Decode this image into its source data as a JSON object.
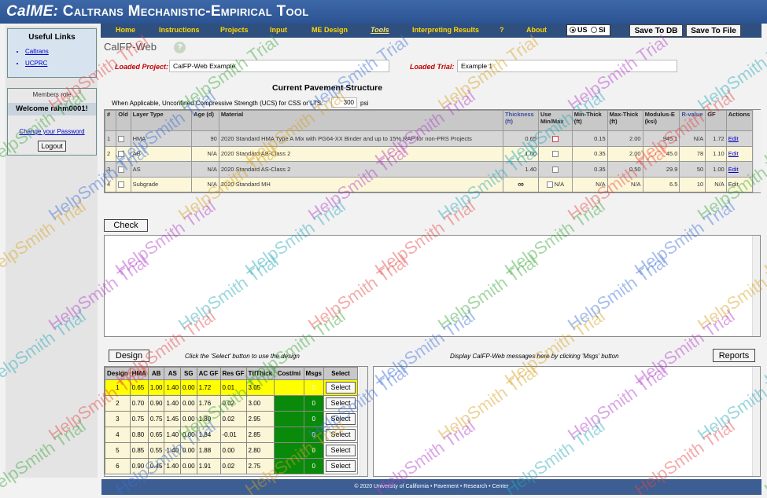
{
  "app": {
    "title_prefix": "CalME:",
    "title_rest": "Caltrans Mechanistic-Empirical Tool"
  },
  "nav": {
    "items": [
      "Home",
      "Instructions",
      "Projects",
      "Input",
      "ME Design",
      "Tools",
      "Interpreting Results",
      "?",
      "About"
    ],
    "active": "Tools"
  },
  "units": {
    "us": "US",
    "si": "SI",
    "selected": "US"
  },
  "buttons": {
    "save_db": "Save To DB",
    "save_file": "Save To File",
    "logout": "Logout",
    "check": "Check",
    "design": "Design",
    "reports": "Reports"
  },
  "sidebar": {
    "useful_links_title": "Useful Links",
    "links": [
      "Caltrans",
      "UCPRC"
    ],
    "members_role": "Members role",
    "welcome": "Welcome rahm0001!",
    "change_password": "Change your Password"
  },
  "page": {
    "title": "CalFP-Web",
    "help_icon": "?",
    "loaded_project_label": "Loaded Project:",
    "loaded_project_value": "CalFP-Web Example",
    "loaded_trial_label": "Loaded Trial:",
    "loaded_trial_value": "Example 1",
    "structure_title": "Current Pavement Structure",
    "ucs_text": "When Applicable, Unconfined Compressive Strength (UCS) for CSS or LTS:",
    "ucs_value": "300",
    "ucs_unit": "psi"
  },
  "structure_table": {
    "headers": [
      "#",
      "Old",
      "Layer Type",
      "Age (d)",
      "Material",
      "Thickness (ft)",
      "Use Min/Max",
      "Min-Thick (ft)",
      "Max-Thick (ft)",
      "Modulus-E (ksi)",
      "R-value",
      "GF",
      "Actions"
    ],
    "rows": [
      {
        "n": "1",
        "type": "HMA",
        "age": "90",
        "material": "2020 Standard HMA Type A Mix with PG64-XX Binder and up to 15% RAP for non-PRS Projects",
        "thick": "0.65",
        "use": "checkbox",
        "min": "0.15",
        "max": "2.00",
        "modulus": "945.1",
        "rvalue": "N/A",
        "gf": "1.72",
        "action": "Edit"
      },
      {
        "n": "2",
        "type": "AB",
        "age": "N/A",
        "material": "2020 Standard AB-Class 2",
        "thick": "1.00",
        "use": "checkbox",
        "min": "0.35",
        "max": "2.00",
        "modulus": "45.0",
        "rvalue": "78",
        "gf": "1.10",
        "action": "Edit"
      },
      {
        "n": "3",
        "type": "AS",
        "age": "N/A",
        "material": "2020 Standard AS-Class 2",
        "thick": "1.40",
        "use": "checkbox",
        "min": "0.35",
        "max": "0.50",
        "modulus": "29.9",
        "rvalue": "50",
        "gf": "1.00",
        "action": "Edit"
      },
      {
        "n": "4",
        "type": "Subgrade",
        "age": "N/A",
        "material": "2020 Standard MH",
        "thick": "∞",
        "use": "N/A",
        "min": "N/A",
        "max": "N/A",
        "modulus": "6.5",
        "rvalue": "10",
        "gf": "N/A",
        "action": "Edit"
      }
    ]
  },
  "design": {
    "hint_left": "Click the 'Select' button to use the design",
    "hint_right": "Display CalFP-Web messages here by clicking 'Msgs' button",
    "headers": [
      "Design",
      "HMA",
      "AB",
      "AS",
      "SG",
      "AC GF",
      "Res GF",
      "TtlThick",
      "Cost/mi",
      "Msgs",
      "Select"
    ],
    "rows": [
      {
        "d": "1",
        "hma": "0.65",
        "ab": "1.00",
        "as": "1.40",
        "sg": "0.00",
        "acgf": "1.72",
        "resgf": "0.01",
        "ttl": "3.05",
        "cost": "",
        "msgs": "0",
        "sel": "Select"
      },
      {
        "d": "2",
        "hma": "0.70",
        "ab": "0.90",
        "as": "1.40",
        "sg": "0.00",
        "acgf": "1.76",
        "resgf": "0.02",
        "ttl": "3.00",
        "cost": "",
        "msgs": "0",
        "sel": "Select"
      },
      {
        "d": "3",
        "hma": "0.75",
        "ab": "0.75",
        "as": "1.45",
        "sg": "0.00",
        "acgf": "1.80",
        "resgf": "0.02",
        "ttl": "2.95",
        "cost": "",
        "msgs": "0",
        "sel": "Select"
      },
      {
        "d": "4",
        "hma": "0.80",
        "ab": "0.65",
        "as": "1.40",
        "sg": "0.00",
        "acgf": "1.84",
        "resgf": "-0.01",
        "ttl": "2.85",
        "cost": "",
        "msgs": "0",
        "sel": "Select"
      },
      {
        "d": "5",
        "hma": "0.85",
        "ab": "0.55",
        "as": "1.40",
        "sg": "0.00",
        "acgf": "1.88",
        "resgf": "0.00",
        "ttl": "2.80",
        "cost": "",
        "msgs": "0",
        "sel": "Select"
      },
      {
        "d": "6",
        "hma": "0.90",
        "ab": "0.45",
        "as": "1.40",
        "sg": "0.00",
        "acgf": "1.91",
        "resgf": "0.02",
        "ttl": "2.75",
        "cost": "",
        "msgs": "0",
        "sel": "Select"
      }
    ]
  },
  "footer": "© 2020 University of California • Pavement • Research • Center",
  "watermark": "HelpSmith Trial",
  "colors": {
    "title_bar": "#2c5391",
    "nav_link": "#ffd700",
    "label_red": "#c00000",
    "selected_row": "#ffff00",
    "cost_cell": "#0a8a0a"
  }
}
